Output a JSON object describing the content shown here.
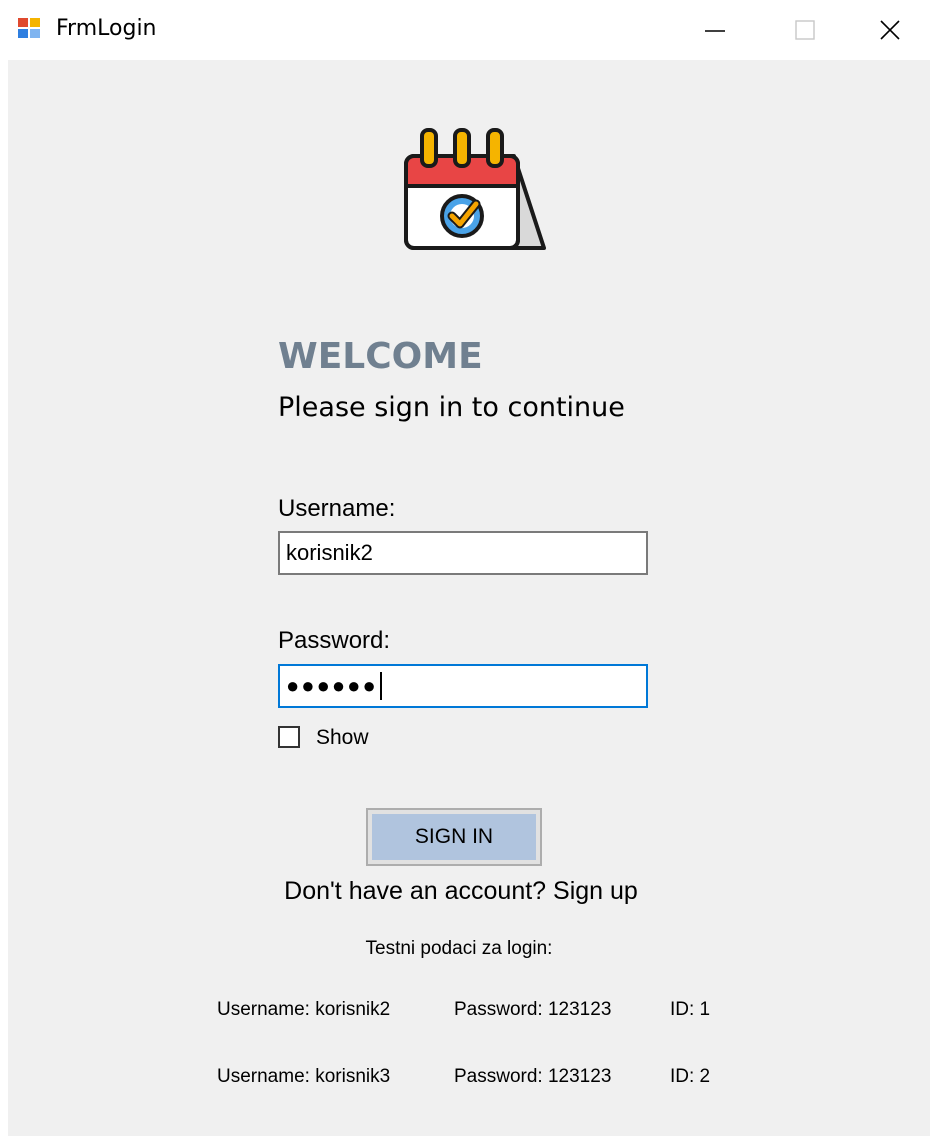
{
  "window": {
    "title": "FrmLogin",
    "minimize_symbol": "—",
    "close_symbol": "✕"
  },
  "logo": {
    "icon": "calendar-check-icon"
  },
  "header": {
    "welcome": "WELCOME",
    "subtitle": "Please sign in to continue"
  },
  "form": {
    "username_label": "Username:",
    "username_value": "korisnik2",
    "password_label": "Password:",
    "password_masked": "●●●●●●",
    "show_checkbox_label": "Show",
    "show_checked": false,
    "signin_label": "SIGN IN",
    "signup_text": "Don't have an account? Sign up"
  },
  "test_data": {
    "heading": "Testni podaci za login:",
    "rows": [
      {
        "username": "Username: korisnik2",
        "password": "Password: 123123",
        "id": "ID: 1"
      },
      {
        "username": "Username: korisnik3",
        "password": "Password: 123123",
        "id": "ID: 2"
      }
    ]
  },
  "colors": {
    "welcome": "#708090",
    "signin_button": "#b0c4de",
    "client_background": "#f0f0f0",
    "focus_border": "#0078d7"
  }
}
